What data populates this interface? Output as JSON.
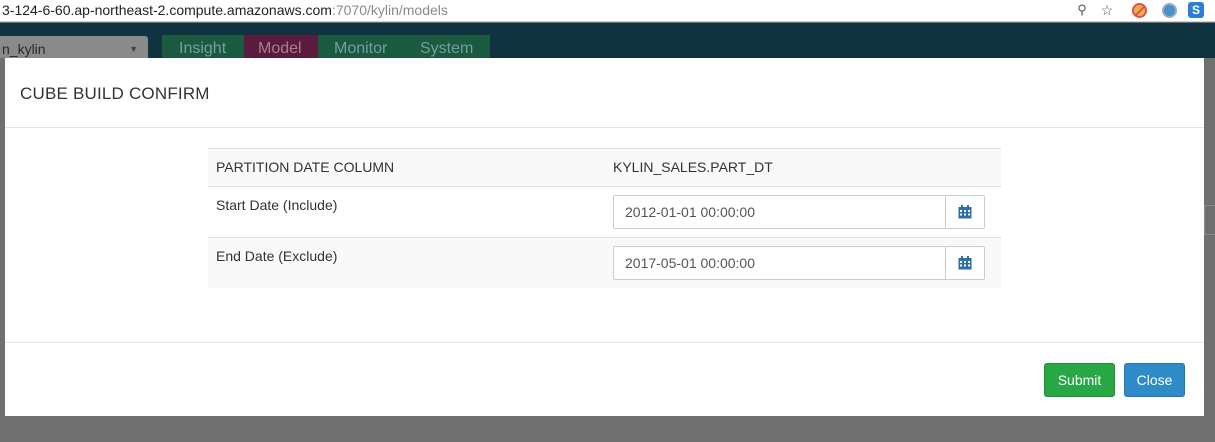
{
  "browser": {
    "url_host": "3-124-6-60.ap-northeast-2.compute.amazonaws.com",
    "url_rest": ":7070/kylin/models",
    "extensions": [
      "key-icon",
      "star-icon",
      "block-icon",
      "drive-icon",
      "s-extension-icon"
    ]
  },
  "app": {
    "project_select": "n_kylin",
    "nav": [
      "Insight",
      "Model",
      "Monitor",
      "System"
    ],
    "active_nav": "Model"
  },
  "modal": {
    "title": "CUBE BUILD CONFIRM",
    "rows": {
      "partition_label": "PARTITION DATE COLUMN",
      "partition_value": "KYLIN_SALES.PART_DT",
      "start_label": "Start Date (Include)",
      "start_value": "2012-01-01 00:00:00",
      "end_label": "End Date (Exclude)",
      "end_value": "2017-05-01 00:00:00"
    },
    "buttons": {
      "submit": "Submit",
      "close": "Close"
    }
  },
  "colors": {
    "submit": "#28a745",
    "close": "#2f8ac8",
    "calendar_icon": "#2d6fa8"
  }
}
